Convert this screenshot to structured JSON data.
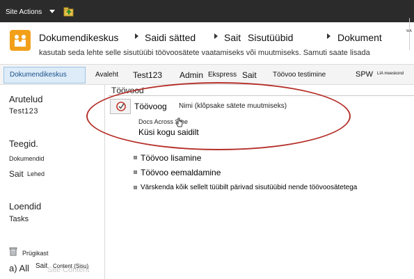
{
  "topbar": {
    "site_actions": "Site Actions"
  },
  "header": {
    "breadcrumbs": [
      "Dokumendikeskus",
      "Saidi sätted",
      "Sait",
      "Sisutüübid",
      "Dokument"
    ],
    "breadcrumb_tiny": "WA",
    "description": "kasutab seda lehte selle sisutüübi töövoosätete vaatamiseks või muutmiseks. Samuti saate lisada"
  },
  "topnav": {
    "items": [
      "Dokumendikeskus",
      "Avaleht",
      "Test123",
      "Admin",
      "Ekspress",
      "Sait",
      "Töövoo testimine",
      "SPW",
      "LIA meeskond"
    ]
  },
  "sidebar": {
    "arutelud": "Arutelud",
    "test123": "Test123",
    "teegid": "Teegid.",
    "dokumendid": "Dokumendid",
    "sait": "Sait",
    "lehed": "Lehed",
    "loendid": "Loendid",
    "tasks": "Tasks",
    "recycle": "Prügikast",
    "all_prefix": "a) All",
    "site_content_1": "Sait",
    "site_content_2": "Content (Sisu)",
    "ghost": "Site Content"
  },
  "main": {
    "title": "Töövood",
    "workflow_title": "Töövoog",
    "workflow_hint": "Nimi (klõpsake sätete muutmiseks)",
    "docs_across": "Docs Across Sthe",
    "ask_site": "Küsi kogu saidilt",
    "actions": [
      "Töövoo lisamine",
      "Töövoo eemaldamine",
      "Värskenda kõik sellelt tüübilt pärivad sisutüübid nende töövoosätetega"
    ]
  }
}
